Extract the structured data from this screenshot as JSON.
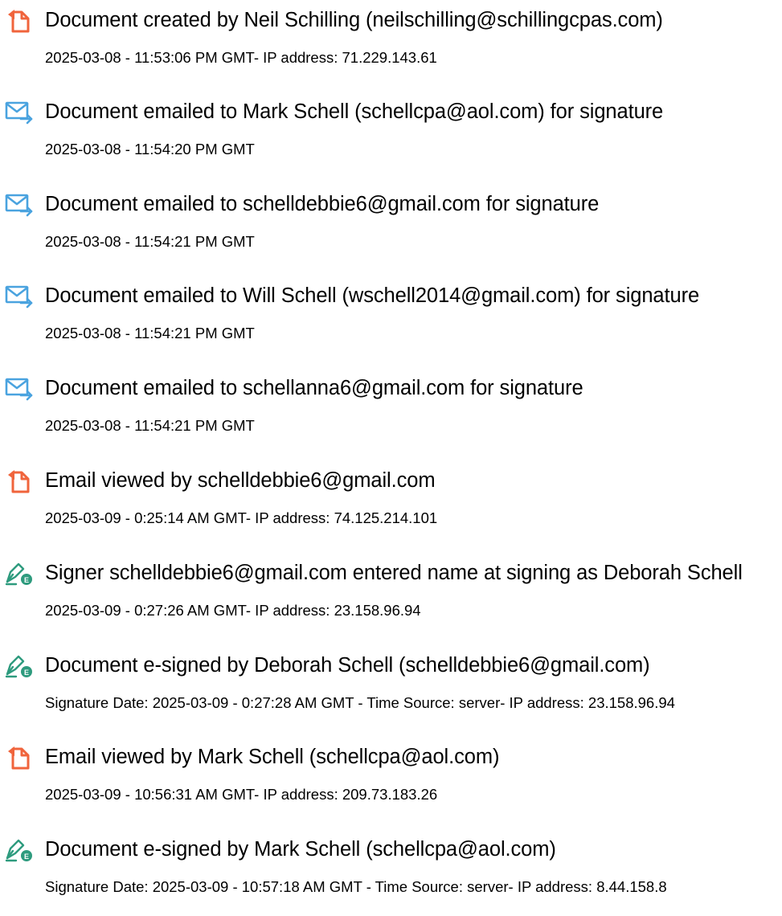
{
  "colors": {
    "document_icon": "#f0643c",
    "email_icon": "#4aa3df",
    "sign_pen": "#2e9b7e",
    "sign_badge": "#2e9b7e"
  },
  "events": [
    {
      "icon": "document-icon",
      "title": "Document created by Neil Schilling (neilschilling@schillingcpas.com)",
      "detail": "2025-03-08 - 11:53:06 PM GMT- IP address: 71.229.143.61"
    },
    {
      "icon": "email-send-icon",
      "title": "Document emailed to Mark Schell (schellcpa@aol.com) for signature",
      "detail": "2025-03-08 - 11:54:20 PM GMT"
    },
    {
      "icon": "email-send-icon",
      "title": "Document emailed to schelldebbie6@gmail.com for signature",
      "detail": "2025-03-08 - 11:54:21 PM GMT"
    },
    {
      "icon": "email-send-icon",
      "title": "Document emailed to Will Schell (wschell2014@gmail.com) for signature",
      "detail": "2025-03-08 - 11:54:21 PM GMT"
    },
    {
      "icon": "email-send-icon",
      "title": "Document emailed to schellanna6@gmail.com for signature",
      "detail": "2025-03-08 - 11:54:21 PM GMT"
    },
    {
      "icon": "document-icon",
      "title": "Email viewed by schelldebbie6@gmail.com",
      "detail": "2025-03-09 - 0:25:14 AM GMT- IP address: 74.125.214.101"
    },
    {
      "icon": "esign-pen-icon",
      "title": "Signer schelldebbie6@gmail.com entered name at signing as Deborah Schell",
      "detail": "2025-03-09 - 0:27:26 AM GMT- IP address: 23.158.96.94"
    },
    {
      "icon": "esign-pen-icon",
      "title": "Document e-signed by Deborah Schell (schelldebbie6@gmail.com)",
      "detail": "Signature Date: 2025-03-09 - 0:27:28 AM GMT - Time Source: server- IP address: 23.158.96.94"
    },
    {
      "icon": "document-icon",
      "title": "Email viewed by Mark Schell (schellcpa@aol.com)",
      "detail": "2025-03-09 - 10:56:31 AM GMT- IP address: 209.73.183.26"
    },
    {
      "icon": "esign-pen-icon",
      "title": "Document e-signed by Mark Schell (schellcpa@aol.com)",
      "detail": "Signature Date: 2025-03-09 - 10:57:18 AM GMT - Time Source: server- IP address: 8.44.158.8"
    }
  ]
}
